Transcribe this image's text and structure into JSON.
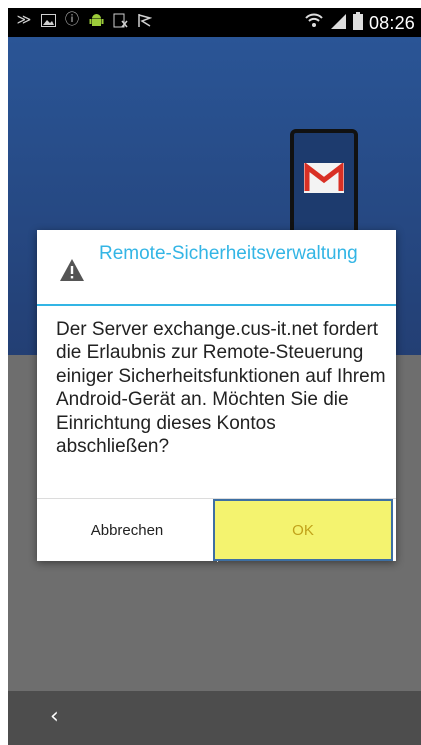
{
  "status_bar": {
    "time": "08:26",
    "left_icons": [
      "nfc-icon",
      "image-icon",
      "alert-icon",
      "android-icon",
      "no-sim-icon",
      "flag-icon"
    ],
    "right_icons": [
      "wifi-icon",
      "signal-icon",
      "battery-icon"
    ]
  },
  "dialog": {
    "title": "Remote-Sicherheitsverwaltung",
    "message": "Der Server exchange.cus-it.net fordert die Erlaubnis zur Remote-Steuerung einiger Sicherheitsfunktionen auf Ihrem Android-Gerät an. Möchten Sie die Einrichtung dieses Kontos abschließen?",
    "cancel_label": "Abbrechen",
    "ok_label": "OK"
  },
  "colors": {
    "accent": "#33b5e5",
    "app_background": "#2a5596",
    "highlight": "#f4f36f"
  }
}
